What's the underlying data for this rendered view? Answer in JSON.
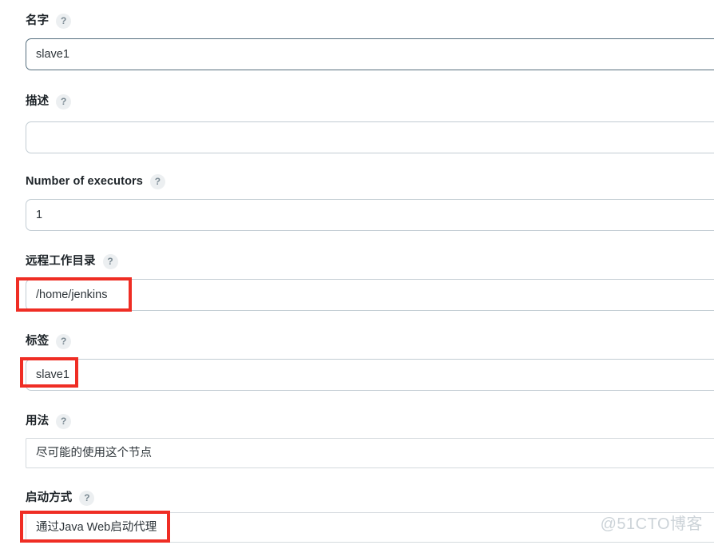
{
  "page": {
    "watermark": "@51CTO博客",
    "help_glyph": "?",
    "accent_annotation_color": "#ef2d24",
    "focus_border_color": "#566f7e",
    "border_color": "#c2ccd3"
  },
  "fields": [
    {
      "name": "node-name",
      "label": "名字",
      "value": "slave1",
      "placeholder": "",
      "type": "text",
      "focused": true,
      "annotated": false
    },
    {
      "name": "description",
      "label": "描述",
      "value": "",
      "placeholder": "",
      "type": "text",
      "focused": false,
      "annotated": false
    },
    {
      "name": "number-of-executors",
      "label": "Number of executors",
      "value": "1",
      "placeholder": "",
      "type": "text",
      "focused": false,
      "annotated": false
    },
    {
      "name": "remote-root-directory",
      "label": "远程工作目录",
      "value": "/home/jenkins",
      "placeholder": "",
      "type": "text",
      "focused": false,
      "annotated": true
    },
    {
      "name": "labels",
      "label": "标签",
      "value": "slave1",
      "placeholder": "",
      "type": "text",
      "focused": false,
      "annotated": true
    },
    {
      "name": "usage",
      "label": "用法",
      "value": "尽可能的使用这个节点",
      "placeholder": "",
      "type": "select",
      "focused": false,
      "annotated": false
    },
    {
      "name": "launch-method",
      "label": "启动方式",
      "value": "通过Java Web启动代理",
      "placeholder": "",
      "type": "select",
      "focused": false,
      "annotated": true
    }
  ]
}
